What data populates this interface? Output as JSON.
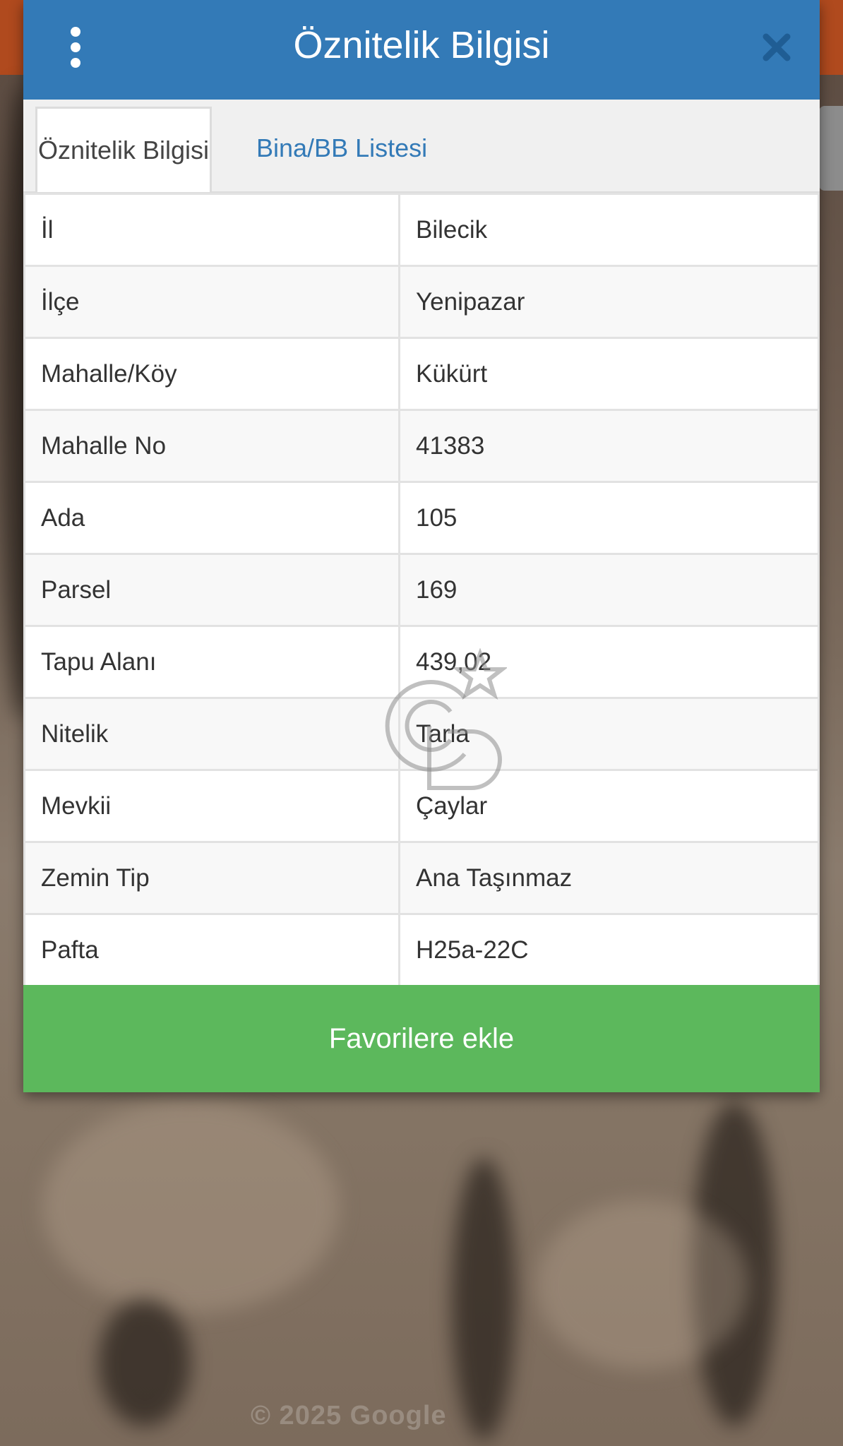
{
  "header": {
    "title": "Öznitelik Bilgisi",
    "menu_icon": "more-vertical-icon",
    "close_icon": "close-icon",
    "color": "#337ab7"
  },
  "tabs": [
    {
      "label": "Öznitelik Bilgisi",
      "active": true
    },
    {
      "label": "Bina/BB Listesi",
      "active": false
    }
  ],
  "attributes": [
    {
      "key": "İl",
      "value": "Bilecik"
    },
    {
      "key": "İlçe",
      "value": "Yenipazar"
    },
    {
      "key": "Mahalle/Köy",
      "value": "Kükürt"
    },
    {
      "key": "Mahalle No",
      "value": "41383"
    },
    {
      "key": "Ada",
      "value": "105"
    },
    {
      "key": "Parsel",
      "value": "169"
    },
    {
      "key": "Tapu Alanı",
      "value": "439,02"
    },
    {
      "key": "Nitelik",
      "value": "Tarla"
    },
    {
      "key": "Mevkii",
      "value": "Çaylar"
    },
    {
      "key": "Zemin Tip",
      "value": "Ana Taşınmaz"
    },
    {
      "key": "Pafta",
      "value": "H25a-22C"
    }
  ],
  "footer": {
    "favorite_label": "Favorilere ekle",
    "button_color": "#5cb85c"
  },
  "map": {
    "attribution": "© 2025 Google"
  }
}
